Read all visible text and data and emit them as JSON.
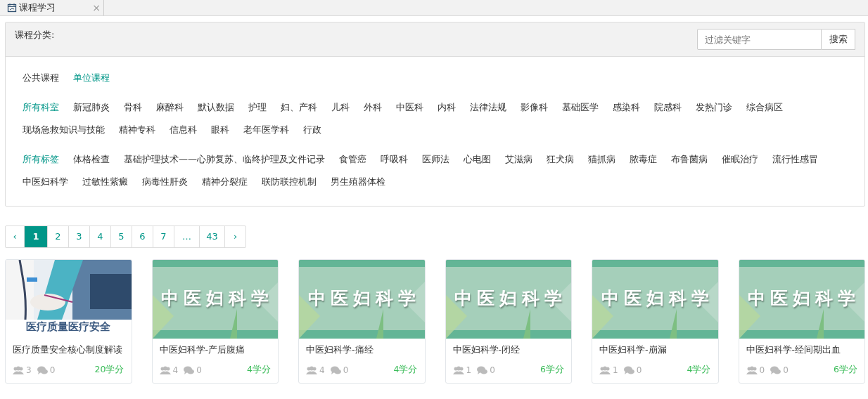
{
  "tab": {
    "title": "课程学习",
    "close": "×"
  },
  "filter": {
    "title": "课程分类:",
    "search": {
      "placeholder": "过滤关键字",
      "button": "搜索"
    },
    "groups": [
      {
        "items": [
          {
            "label": "公共课程",
            "selected": false
          },
          {
            "label": "单位课程",
            "selected": true
          }
        ]
      },
      {
        "items": [
          {
            "label": "所有科室",
            "selected": true
          },
          {
            "label": "新冠肺炎",
            "selected": false
          },
          {
            "label": "骨科",
            "selected": false
          },
          {
            "label": "麻醉科",
            "selected": false
          },
          {
            "label": "默认数据",
            "selected": false
          },
          {
            "label": "护理",
            "selected": false
          },
          {
            "label": "妇、产科",
            "selected": false
          },
          {
            "label": "儿科",
            "selected": false
          },
          {
            "label": "外科",
            "selected": false
          },
          {
            "label": "中医科",
            "selected": false
          },
          {
            "label": "内科",
            "selected": false
          },
          {
            "label": "法律法规",
            "selected": false
          },
          {
            "label": "影像科",
            "selected": false
          },
          {
            "label": "基础医学",
            "selected": false
          },
          {
            "label": "感染科",
            "selected": false
          },
          {
            "label": "院感科",
            "selected": false
          },
          {
            "label": "发热门诊",
            "selected": false
          },
          {
            "label": "综合病区",
            "selected": false
          },
          {
            "label": "现场急救知识与技能",
            "selected": false
          },
          {
            "label": "精神专科",
            "selected": false
          },
          {
            "label": "信息科",
            "selected": false
          },
          {
            "label": "眼科",
            "selected": false
          },
          {
            "label": "老年医学科",
            "selected": false
          },
          {
            "label": "行政",
            "selected": false
          }
        ]
      },
      {
        "items": [
          {
            "label": "所有标签",
            "selected": true
          },
          {
            "label": "体格检查",
            "selected": false
          },
          {
            "label": "基础护理技术——心肺复苏、临终护理及文件记录",
            "selected": false
          },
          {
            "label": "食管癌",
            "selected": false
          },
          {
            "label": "呼吸科",
            "selected": false
          },
          {
            "label": "医师法",
            "selected": false
          },
          {
            "label": "心电图",
            "selected": false
          },
          {
            "label": "艾滋病",
            "selected": false
          },
          {
            "label": "狂犬病",
            "selected": false
          },
          {
            "label": "猫抓病",
            "selected": false
          },
          {
            "label": "脓毒症",
            "selected": false
          },
          {
            "label": "布鲁菌病",
            "selected": false
          },
          {
            "label": "催眠治疗",
            "selected": false
          },
          {
            "label": "流行性感冒",
            "selected": false
          },
          {
            "label": "中医妇科学",
            "selected": false
          },
          {
            "label": "过敏性紫癜",
            "selected": false
          },
          {
            "label": "病毒性肝炎",
            "selected": false
          },
          {
            "label": "精神分裂症",
            "selected": false
          },
          {
            "label": "联防联控机制",
            "selected": false
          },
          {
            "label": "男生殖器体检",
            "selected": false
          }
        ]
      }
    ]
  },
  "pagination": {
    "prev": "‹",
    "next": "›",
    "pages": [
      {
        "label": "1",
        "selected": true
      },
      {
        "label": "2",
        "selected": false
      },
      {
        "label": "3",
        "selected": false
      },
      {
        "label": "4",
        "selected": false
      },
      {
        "label": "5",
        "selected": false
      },
      {
        "label": "6",
        "selected": false
      },
      {
        "label": "7",
        "selected": false
      },
      {
        "label": "…",
        "selected": false
      },
      {
        "label": "43",
        "selected": false
      }
    ]
  },
  "courses": [
    {
      "cover": {
        "caption": "医疗质量医疗安全"
      },
      "title": "医疗质量安全核心制度解读",
      "learners": "3",
      "comments": "0",
      "credits": "20学分"
    },
    {
      "cover": {
        "kind": "banner",
        "caption": "中医妇科学"
      },
      "title": "中医妇科学-产后腹痛",
      "learners": "4",
      "comments": "0",
      "credits": "4学分"
    },
    {
      "cover": {
        "kind": "banner",
        "caption": "中医妇科学"
      },
      "title": "中医妇科学-痛经",
      "learners": "4",
      "comments": "0",
      "credits": "4学分"
    },
    {
      "cover": {
        "kind": "banner",
        "caption": "中医妇科学"
      },
      "title": "中医妇科学-闭经",
      "learners": "1",
      "comments": "0",
      "credits": "6学分"
    },
    {
      "cover": {
        "kind": "banner",
        "caption": "中医妇科学"
      },
      "title": "中医妇科学-崩漏",
      "learners": "1",
      "comments": "0",
      "credits": "4学分"
    },
    {
      "cover": {
        "kind": "banner",
        "caption": "中医妇科学"
      },
      "title": "中医妇科学-经间期出血",
      "learners": "0",
      "comments": "0",
      "credits": "6学分"
    }
  ]
}
